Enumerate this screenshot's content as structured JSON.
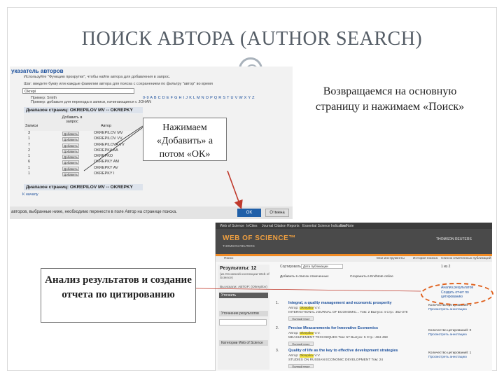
{
  "slide": {
    "title": "ПОИСК АВТОРА (AUTHOR SEARCH)"
  },
  "callouts": {
    "add_ok": "Нажимаем «Добавить» а потом «ОК»",
    "return_search": "Возвращаемся на основную страницу и нажимаем «Поиск»",
    "analysis": "Анализ результатов и создание отчета по цитированию"
  },
  "author_index": {
    "title": "указатель авторов",
    "desc1": "Используйте \"Функцию прокрутки\", чтобы найти автора для добавления в запрос.",
    "desc2": "Шаг: введите букву или каждые фамилии автора для поиска с сохранением по фильтру \"автор\" во время",
    "search_value": "Okrepi",
    "desc3": "Пример: Smith",
    "desc4": "Пример: добавьте для перехода в записи, начинающиеся с JOHAN",
    "alphabet": "0-9 A B C D E F G H I J K L M N O P Q R S T U V W X Y Z",
    "range_label": "Диапазон страниц: OKREPILOV MV -- OKREPKY",
    "col_records": "Записи",
    "col_add": "Добавить в запрос",
    "col_author": "Автор",
    "rows": [
      {
        "n": "3",
        "btn": "Добавить",
        "author": "OKREPILOV MV"
      },
      {
        "n": "1",
        "btn": "Добавить",
        "author": "OKREPILOV VV"
      },
      {
        "n": "7",
        "btn": "Добавить",
        "author": "OKREPILOVA VV"
      },
      {
        "n": "2",
        "btn": "Добавить",
        "author": "OKREPKA AA"
      },
      {
        "n": "1",
        "btn": "Добавить",
        "author": "OKREPKO"
      },
      {
        "n": "6",
        "btn": "Добавить",
        "author": "OKREPKY AM"
      },
      {
        "n": "1",
        "btn": "Добавить",
        "author": "OKREPKY AV"
      },
      {
        "n": "1",
        "btn": "Добавить",
        "author": "OKREPKY I"
      }
    ],
    "range_label2": "Диапазон страниц: OKREPILOV MV -- OKREPKY",
    "back_top": "К началу",
    "footer_text": "авторов, выбранные ниже, необходимо перенести в поле Автор на странице поиска.",
    "ok_label": "OK",
    "cancel_label": "Отмена"
  },
  "wos": {
    "topnav": [
      "Web of Science",
      "InCites",
      "Journal Citation Reports",
      "Essential Science Indicators",
      "EndNote"
    ],
    "logo": "WEB OF SCIENCE™",
    "logo_sub": "THOMSON REUTERS",
    "brand": "THOMSON REUTERS",
    "nav": [
      "Поиск",
      "Мои инструменты",
      "История поиска",
      "Список отмеченных публикаций"
    ],
    "results_heading": "Результаты: 12",
    "results_sub": "(из Основной коллекции Web of Science)",
    "results_for": "Вы искали: АВТОР: (Okrepilov)",
    "refine_btn": "Уточнить",
    "filter_heading": "Уточнение результатов",
    "search_in": "Поиск в пределах результатов...",
    "cat_heading": "Категории Web of Science",
    "sort_label": "Сортировать по:",
    "sort_value": "Дата публикации",
    "pager": "1 из 2",
    "tool_add": "Добавить в список отмеченных",
    "tool_save": "Сохранить в EndNote online",
    "report_link": "Анализ результатов",
    "report_link2": "Создать отчет по цитированию",
    "records": [
      {
        "num": "1.",
        "title": "Integral, a quality management and economic prosperity",
        "author": "Автор: Okrepilov V.V.",
        "source": "INTERNATIONAL JOURNAL OF ECONOMIC... Том: 2 Выпуск: 4 Стр.: 352-378",
        "fulltext": "Полный текст",
        "citations": "Количество цитирований: 1",
        "citations_link": "Просмотреть аннотацию"
      },
      {
        "num": "2.",
        "title": "Precise Measurements for Innovative Economics",
        "author": "Автор: Okrepilov V.V.",
        "source": "MEASUREMENT TECHNIQUES Том: 57 Выпуск: 5 Стр.: 464-468",
        "fulltext": "Полный текст",
        "citations": "Количество цитирований: 0",
        "citations_link": "Просмотреть аннотацию"
      },
      {
        "num": "3.",
        "title": "Quality of life as the key to effective development strategies",
        "author": "Автор: Okrepilov V.V.",
        "source": "STUDIES ON RUSSIAN ECONOMIC DEVELOPMENT Том: 24",
        "fulltext": "Полный текст",
        "citations": "Количество цитирований: 1",
        "citations_link": "Просмотреть аннотацию"
      }
    ]
  },
  "colors": {
    "accent_orange": "#f08a24",
    "link_blue": "#1b4f9c",
    "highlight_yellow": "#f5e43a",
    "arrow_red": "#c0392b"
  }
}
